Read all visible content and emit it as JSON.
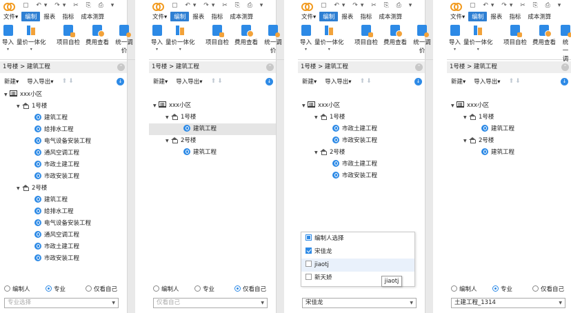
{
  "quick_icons": "▢ ↶▾ ↷▾ ✂ ⎘ ⎙ ▾",
  "tabs": [
    "文件▾",
    "编制",
    "报表",
    "指标",
    "成本测算"
  ],
  "ribbon": {
    "import": "导入",
    "quantity_price": "量价一体化",
    "self_check": "项目自检",
    "fee_view": "费用查看",
    "unify": "统一调价"
  },
  "breadcrumb": "1号楼 > 建筑工程",
  "toolbar": {
    "new": "新建▾",
    "import_export": "导入导出▾"
  },
  "tree_panel1": {
    "root": "xxx小区",
    "b1": "1号楼",
    "b1_items": [
      "建筑工程",
      "给排水工程",
      "电气设备安装工程",
      "通风空调工程",
      "市政土建工程",
      "市政安装工程"
    ],
    "b2": "2号楼",
    "b2_items": [
      "建筑工程",
      "给排水工程",
      "电气设备安装工程",
      "通风空调工程",
      "市政土建工程",
      "市政安装工程"
    ]
  },
  "tree_panel2": {
    "root": "xxx小区",
    "b1": "1号楼",
    "b1_items": [
      "建筑工程"
    ],
    "b2": "2号楼",
    "b2_items": [
      "建筑工程"
    ]
  },
  "tree_panel3": {
    "root": "xxx小区",
    "b1": "1号楼",
    "b1_items": [
      "市政土建工程",
      "市政安装工程"
    ],
    "b2": "2号楼",
    "b2_items": [
      "市政土建工程",
      "市政安装工程"
    ]
  },
  "tree_panel4": {
    "root": "xxx小区",
    "b1": "1号楼",
    "b1_items": [
      "建筑工程"
    ],
    "b2": "2号楼",
    "b2_items": [
      "建筑工程"
    ]
  },
  "filter": {
    "editor": "编制人",
    "specialty": "专业",
    "mine_only": "仅看自己"
  },
  "select_values": {
    "p1": "专业选择",
    "p2": "仅看自己",
    "p3": "宋佳龙",
    "p4": "土建工程_1314"
  },
  "popup": {
    "header": "编制人选择",
    "options": [
      "宋佳龙",
      "jiaotj",
      "新天娇"
    ],
    "tooltip": "jiaotj"
  }
}
